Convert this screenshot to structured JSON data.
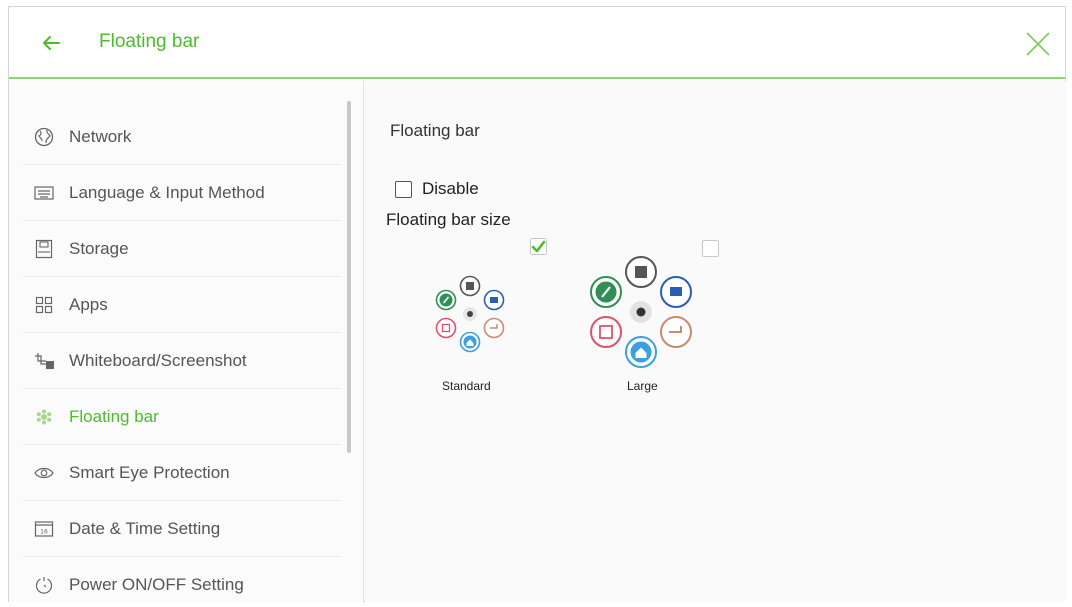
{
  "header": {
    "title": "Floating bar"
  },
  "sidebar": {
    "items": [
      {
        "label": "Network",
        "icon": "globe-icon"
      },
      {
        "label": "Language & Input Method",
        "icon": "keyboard-icon"
      },
      {
        "label": "Storage",
        "icon": "storage-icon"
      },
      {
        "label": "Apps",
        "icon": "apps-grid-icon"
      },
      {
        "label": "Whiteboard/Screenshot",
        "icon": "screenshot-icon"
      },
      {
        "label": "Floating bar",
        "icon": "floating-bar-icon",
        "active": true
      },
      {
        "label": "Smart Eye Protection",
        "icon": "eye-icon"
      },
      {
        "label": "Date & Time Setting",
        "icon": "calendar-icon"
      },
      {
        "label": "Power ON/OFF Setting",
        "icon": "power-icon"
      }
    ]
  },
  "main": {
    "title": "Floating bar",
    "disable_label": "Disable",
    "disable_checked": false,
    "size_label": "Floating bar size",
    "options": [
      {
        "label": "Standard",
        "checked": true
      },
      {
        "label": "Large",
        "checked": false
      }
    ]
  },
  "colors": {
    "accent": "#4cbb2c",
    "header_border": "#8fd36d",
    "bubble_green": "#2f8f55",
    "bubble_blue": "#2a5db8",
    "bubble_brown": "#c98a73",
    "bubble_pink": "#e0506e",
    "bubble_home": "#3aa0e0"
  }
}
